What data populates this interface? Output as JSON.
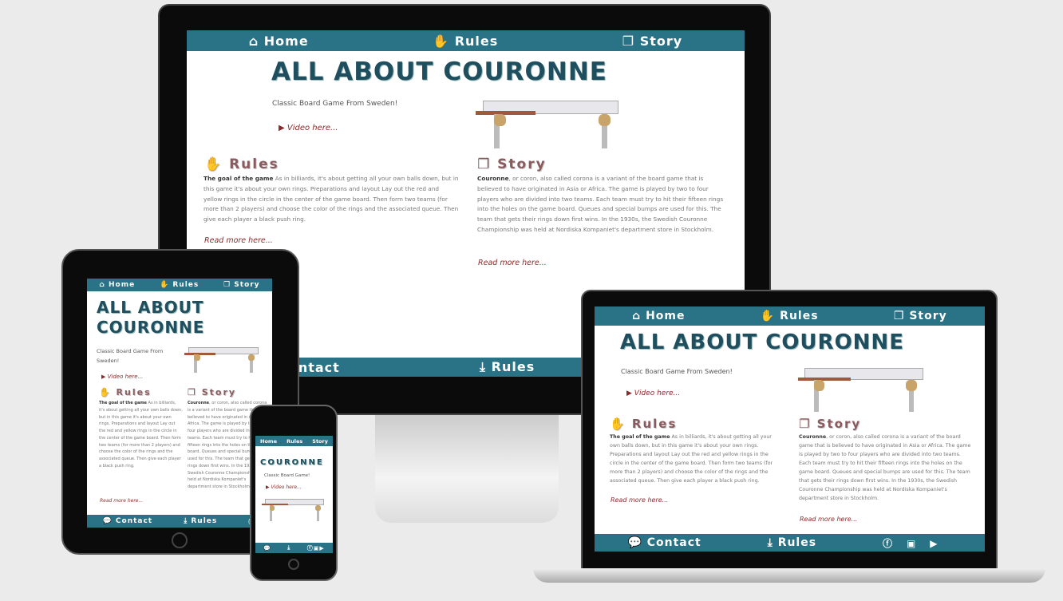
{
  "site": {
    "nav": {
      "home": "Home",
      "rules": "Rules",
      "story": "Story"
    },
    "title": "ALL ABOUT COURONNE",
    "title_mobile": "COURONNE",
    "subtitle": "Classic Board Game From Sweden!",
    "subtitle_mobile": "Classic Board Game!",
    "video": "Video here...",
    "rules": {
      "heading": "Rules",
      "lead": "The goal of the game",
      "body": " As in billiards, it's about getting all your own balls down, but in this game it's about your own rings. Preparations and layout Lay out the red and yellow rings in the circle in the center of the game board. Then form two teams (for more than 2 players) and choose the color of the rings and the associated queue. Then give each player a black push ring.",
      "more": "Read more here..."
    },
    "story": {
      "heading": "Story",
      "lead": "Couronne",
      "body": ", or coron, also called corona is a variant of the board game that is believed to have originated in Asia or Africa. The game is played by two to four players who are divided into two teams. Each team must try to hit their fifteen rings into the holes on the game board. Queues and special bumps are used for this. The team that gets their rings down first wins. In the 1930s, the Swedish Couronne Championship was held at Nordiska Kompaniet's department store in Stockholm.",
      "more": "Read more here..."
    },
    "footer": {
      "contact": "Contact",
      "rules": "Rules"
    }
  },
  "icons": {
    "home": "home-icon",
    "rules": "handshake-icon",
    "story": "window-restore-icon",
    "contact": "comment-icon",
    "download": "download-icon",
    "facebook": "facebook-icon",
    "linkedin": "linkedin-icon",
    "youtube": "youtube-icon",
    "video": "play-circle-icon"
  },
  "colors": {
    "nav": "#2a7285",
    "title": "#1f4f5e",
    "heading": "#8a5a5e",
    "link": "#8b2a2a"
  }
}
